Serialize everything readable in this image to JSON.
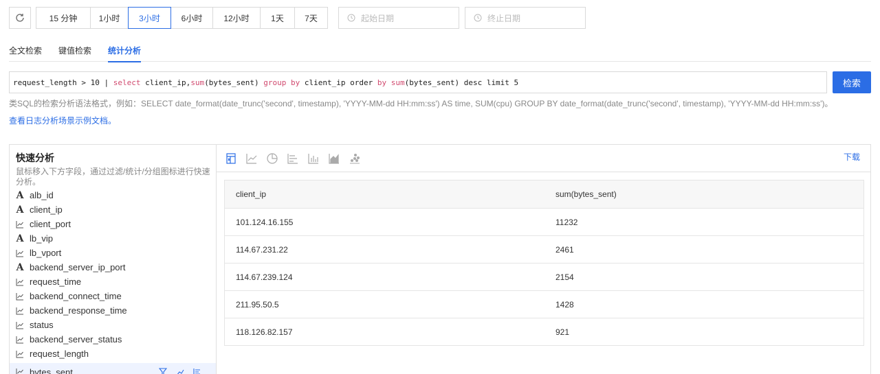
{
  "toolbar": {
    "ranges": [
      {
        "label": "15 分钟",
        "active": false
      },
      {
        "label": "1小时",
        "active": false
      },
      {
        "label": "3小时",
        "active": true
      },
      {
        "label": "6小时",
        "active": false
      },
      {
        "label": "12小时",
        "active": false
      },
      {
        "label": "1天",
        "active": false
      },
      {
        "label": "7天",
        "active": false
      }
    ],
    "start_placeholder": "起始日期",
    "end_placeholder": "终止日期"
  },
  "tabs": [
    {
      "label": "全文检索",
      "active": false
    },
    {
      "label": "键值检索",
      "active": false
    },
    {
      "label": "统计分析",
      "active": true
    }
  ],
  "query": {
    "parts": [
      {
        "text": "request_length > 10 | ",
        "kw": false
      },
      {
        "text": "select",
        "kw": true
      },
      {
        "text": " client_ip,",
        "kw": false
      },
      {
        "text": "sum",
        "kw": true
      },
      {
        "text": "(bytes_sent) ",
        "kw": false
      },
      {
        "text": "group by",
        "kw": true
      },
      {
        "text": " client_ip order ",
        "kw": false
      },
      {
        "text": "by",
        "kw": true
      },
      {
        "text": " ",
        "kw": false
      },
      {
        "text": "sum",
        "kw": true
      },
      {
        "text": "(bytes_sent) desc limit 5",
        "kw": false
      }
    ],
    "search_label": "检索",
    "hint": "类SQL的检索分析语法格式，例如：SELECT date_format(date_trunc('second', timestamp), 'YYYY-MM-dd HH:mm:ss') AS time, SUM(cpu) GROUP BY date_format(date_trunc('second', timestamp), 'YYYY-MM-dd HH:mm:ss')。",
    "doc_link": "查看日志分析场景示例文档。"
  },
  "quick_analysis": {
    "title": "快速分析",
    "desc": "鼠标移入下方字段，通过过滤/统计/分组图标进行快速分析。",
    "fields": [
      {
        "name": "alb_id",
        "type": "text"
      },
      {
        "name": "client_ip",
        "type": "text"
      },
      {
        "name": "client_port",
        "type": "number"
      },
      {
        "name": "lb_vip",
        "type": "text"
      },
      {
        "name": "lb_vport",
        "type": "number"
      },
      {
        "name": "backend_server_ip_port",
        "type": "text"
      },
      {
        "name": "request_time",
        "type": "number"
      },
      {
        "name": "backend_connect_time",
        "type": "number"
      },
      {
        "name": "backend_response_time",
        "type": "number"
      },
      {
        "name": "status",
        "type": "number"
      },
      {
        "name": "backend_server_status",
        "type": "number"
      },
      {
        "name": "request_length",
        "type": "number"
      },
      {
        "name": "bytes_sent",
        "type": "number"
      }
    ]
  },
  "results": {
    "download_label": "下载",
    "chart_icons": [
      "table-icon",
      "line-chart-icon",
      "pie-chart-icon",
      "bar-horizontal-icon",
      "bar-chart-icon",
      "area-chart-icon",
      "scatter-chart-icon"
    ],
    "columns": [
      "client_ip",
      "sum(bytes_sent)"
    ],
    "rows": [
      [
        "101.124.16.155",
        "11232"
      ],
      [
        "114.67.231.22",
        "2461"
      ],
      [
        "114.67.239.124",
        "2154"
      ],
      [
        "211.95.50.5",
        "1428"
      ],
      [
        "118.126.82.157",
        "921"
      ]
    ]
  },
  "colors": {
    "accent": "#2b6de5",
    "keyword": "#d14a6f"
  }
}
